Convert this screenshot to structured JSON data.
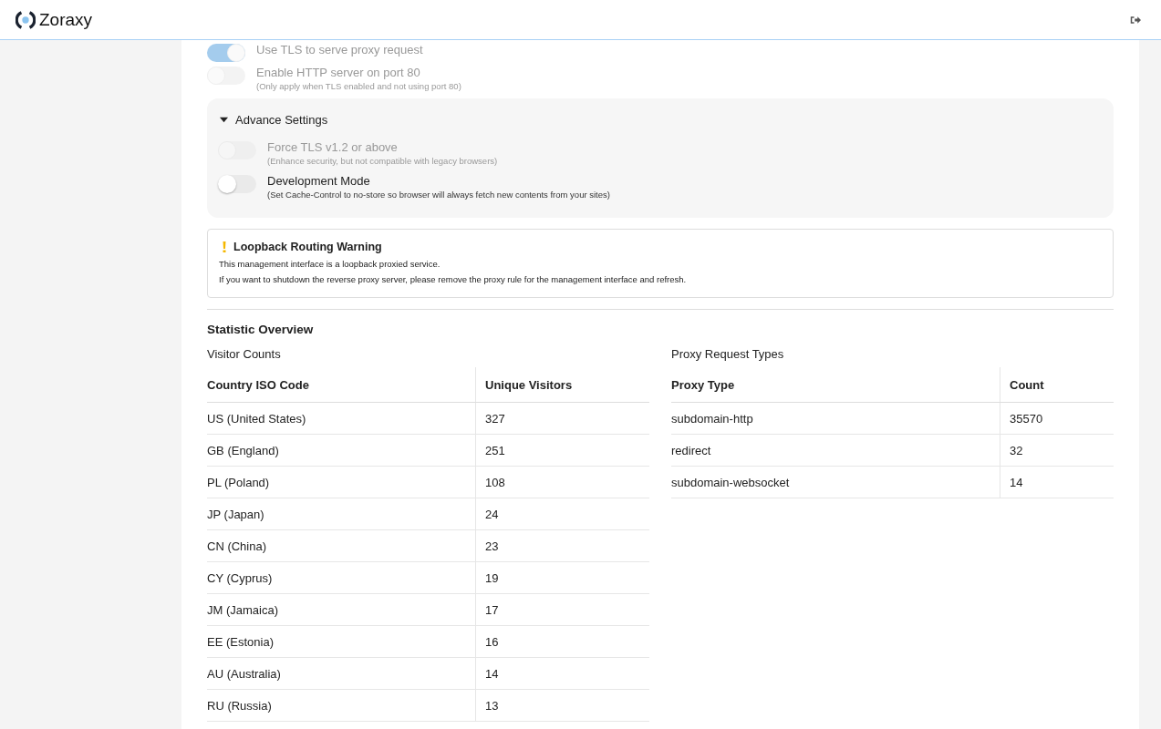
{
  "header": {
    "brand": "Zoraxy"
  },
  "toggles": [
    {
      "label": "Use TLS to serve proxy request",
      "on": true,
      "disabled": true
    },
    {
      "label": "Enable HTTP server on port 80",
      "hint": "(Only apply when TLS enabled and not using port 80)",
      "on": false,
      "disabled": true
    }
  ],
  "advance_settings": {
    "title": "Advance Settings",
    "expanded": true,
    "toggles": [
      {
        "label": "Force TLS v1.2 or above",
        "hint": "(Enhance security, but not compatible with legacy browsers)",
        "on": false,
        "disabled": true
      },
      {
        "label": "Development Mode",
        "hint": "(Set Cache-Control to no-store so browser will always fetch new contents from your sites)",
        "on": false,
        "disabled": false
      }
    ]
  },
  "warning": {
    "title": "Loopback Routing Warning",
    "lines": [
      "This management interface is a loopback proxied service.",
      "If you want to shutdown the reverse proxy server, please remove the proxy rule for the management interface and refresh."
    ]
  },
  "statistics": {
    "title": "Statistic Overview",
    "tables": [
      {
        "title": "Visitor Counts",
        "columns": [
          "Country ISO Code",
          "Unique Visitors"
        ],
        "rows": [
          [
            "US (United States)",
            "327"
          ],
          [
            "GB (England)",
            "251"
          ],
          [
            "PL (Poland)",
            "108"
          ],
          [
            "JP (Japan)",
            "24"
          ],
          [
            "CN (China)",
            "23"
          ],
          [
            "CY (Cyprus)",
            "19"
          ],
          [
            "JM (Jamaica)",
            "17"
          ],
          [
            "EE (Estonia)",
            "16"
          ],
          [
            "AU (Australia)",
            "14"
          ],
          [
            "RU (Russia)",
            "13"
          ]
        ]
      },
      {
        "title": "Proxy Request Types",
        "columns": [
          "Proxy Type",
          "Count"
        ],
        "rows": [
          [
            "subdomain-http",
            "35570"
          ],
          [
            "redirect",
            "32"
          ],
          [
            "subdomain-websocket",
            "14"
          ]
        ]
      }
    ]
  }
}
